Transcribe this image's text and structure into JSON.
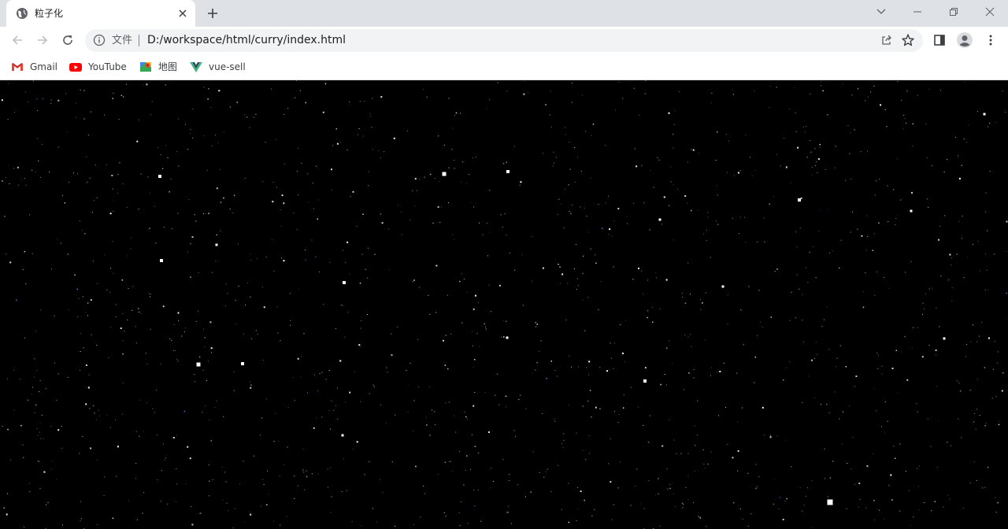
{
  "tab": {
    "title": "粒子化"
  },
  "address_bar": {
    "scheme_label": "文件",
    "url": "D:/workspace/html/curry/index.html"
  },
  "bookmarks": [
    {
      "label": "Gmail",
      "icon": "gmail-icon"
    },
    {
      "label": "YouTube",
      "icon": "youtube-icon"
    },
    {
      "label": "地图",
      "icon": "maps-icon"
    },
    {
      "label": "vue-sell",
      "icon": "vue-icon"
    }
  ],
  "colors": {
    "tabstrip": "#dee1e6",
    "toolbar": "#ffffff",
    "omnibox": "#f1f3f4",
    "page_background": "#000000",
    "particle": "#ffffff"
  }
}
